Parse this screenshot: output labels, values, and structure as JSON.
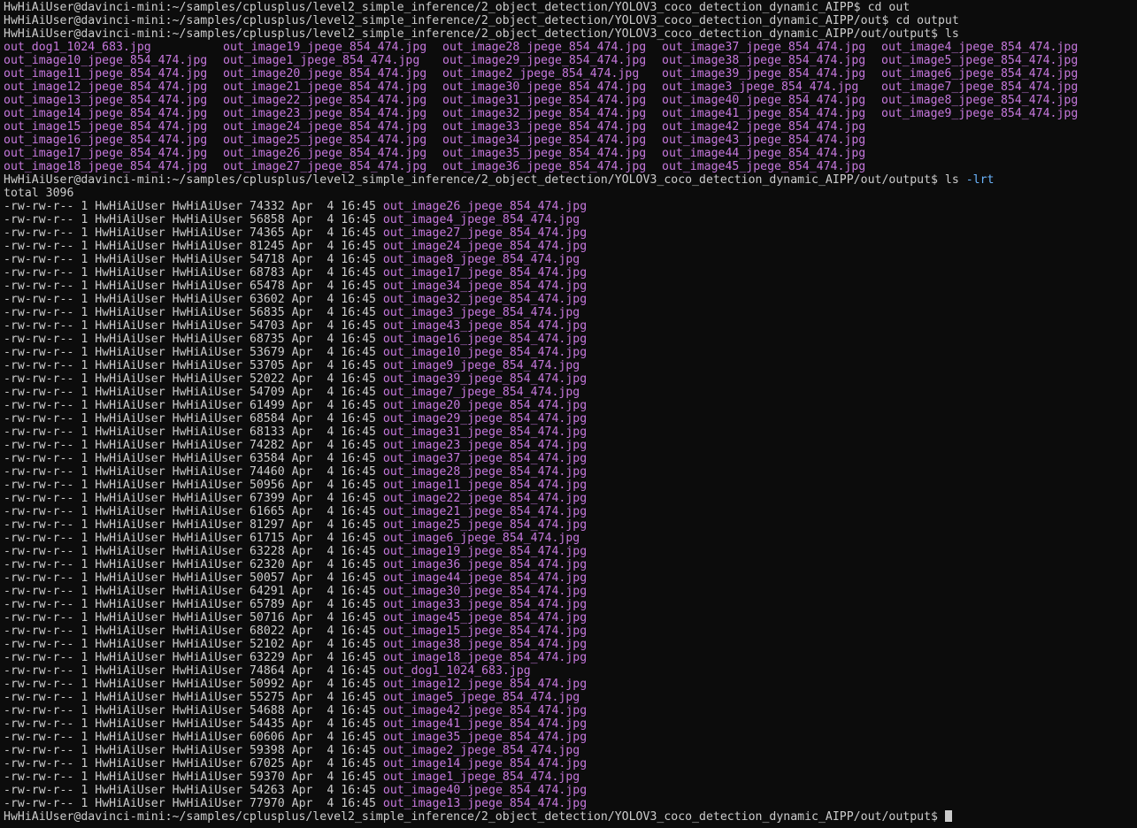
{
  "window": {
    "title": "Terminal"
  },
  "prompt_base": "HwHiAiUser@davinci-mini:~/samples/cplusplus/level2_simple_inference/2_object_detection/YOLOV3_coco_detection_dynamic_AIPP",
  "history": [
    {
      "prompt": "HwHiAiUser@davinci-mini:~/samples/cplusplus/level2_simple_inference/2_object_detection/YOLOV3_coco_detection_dynamic_AIPP$ ",
      "cmd": "cd out"
    },
    {
      "prompt": "HwHiAiUser@davinci-mini:~/samples/cplusplus/level2_simple_inference/2_object_detection/YOLOV3_coco_detection_dynamic_AIPP/out$ ",
      "cmd": "cd output"
    },
    {
      "prompt": "HwHiAiUser@davinci-mini:~/samples/cplusplus/level2_simple_inference/2_object_detection/YOLOV3_coco_detection_dynamic_AIPP/out/output$ ",
      "cmd": "ls"
    }
  ],
  "ls_columns": [
    [
      "out_dog1_1024_683.jpg",
      "out_image10_jpege_854_474.jpg",
      "out_image11_jpege_854_474.jpg",
      "out_image12_jpege_854_474.jpg",
      "out_image13_jpege_854_474.jpg",
      "out_image14_jpege_854_474.jpg",
      "out_image15_jpege_854_474.jpg",
      "out_image16_jpege_854_474.jpg",
      "out_image17_jpege_854_474.jpg",
      "out_image18_jpege_854_474.jpg"
    ],
    [
      "out_image19_jpege_854_474.jpg",
      "out_image1_jpege_854_474.jpg",
      "out_image20_jpege_854_474.jpg",
      "out_image21_jpege_854_474.jpg",
      "out_image22_jpege_854_474.jpg",
      "out_image23_jpege_854_474.jpg",
      "out_image24_jpege_854_474.jpg",
      "out_image25_jpege_854_474.jpg",
      "out_image26_jpege_854_474.jpg",
      "out_image27_jpege_854_474.jpg"
    ],
    [
      "out_image28_jpege_854_474.jpg",
      "out_image29_jpege_854_474.jpg",
      "out_image2_jpege_854_474.jpg",
      "out_image30_jpege_854_474.jpg",
      "out_image31_jpege_854_474.jpg",
      "out_image32_jpege_854_474.jpg",
      "out_image33_jpege_854_474.jpg",
      "out_image34_jpege_854_474.jpg",
      "out_image35_jpege_854_474.jpg",
      "out_image36_jpege_854_474.jpg"
    ],
    [
      "out_image37_jpege_854_474.jpg",
      "out_image38_jpege_854_474.jpg",
      "out_image39_jpege_854_474.jpg",
      "out_image3_jpege_854_474.jpg",
      "out_image40_jpege_854_474.jpg",
      "out_image41_jpege_854_474.jpg",
      "out_image42_jpege_854_474.jpg",
      "out_image43_jpege_854_474.jpg",
      "out_image44_jpege_854_474.jpg",
      "out_image45_jpege_854_474.jpg"
    ],
    [
      "out_image4_jpege_854_474.jpg",
      "out_image5_jpege_854_474.jpg",
      "out_image6_jpege_854_474.jpg",
      "out_image7_jpege_854_474.jpg",
      "out_image8_jpege_854_474.jpg",
      "out_image9_jpege_854_474.jpg"
    ]
  ],
  "lrt_command": {
    "prompt": "HwHiAiUser@davinci-mini:~/samples/cplusplus/level2_simple_inference/2_object_detection/YOLOV3_coco_detection_dynamic_AIPP/out/output$ ",
    "cmd": "ls ",
    "opt": "-lrt"
  },
  "total": "total 3096",
  "listing_common": {
    "perms": "-rw-rw-r--",
    "links": "1",
    "owner": "HwHiAiUser",
    "group": "HwHiAiUser",
    "month": "Apr",
    "day": "4",
    "time": "16:45"
  },
  "listing": [
    {
      "size": "74332",
      "name": "out_image26_jpege_854_474.jpg"
    },
    {
      "size": "56858",
      "name": "out_image4_jpege_854_474.jpg"
    },
    {
      "size": "74365",
      "name": "out_image27_jpege_854_474.jpg"
    },
    {
      "size": "81245",
      "name": "out_image24_jpege_854_474.jpg"
    },
    {
      "size": "54718",
      "name": "out_image8_jpege_854_474.jpg"
    },
    {
      "size": "68783",
      "name": "out_image17_jpege_854_474.jpg"
    },
    {
      "size": "65478",
      "name": "out_image34_jpege_854_474.jpg"
    },
    {
      "size": "63602",
      "name": "out_image32_jpege_854_474.jpg"
    },
    {
      "size": "56835",
      "name": "out_image3_jpege_854_474.jpg"
    },
    {
      "size": "54703",
      "name": "out_image43_jpege_854_474.jpg"
    },
    {
      "size": "68735",
      "name": "out_image16_jpege_854_474.jpg"
    },
    {
      "size": "53679",
      "name": "out_image10_jpege_854_474.jpg"
    },
    {
      "size": "53705",
      "name": "out_image9_jpege_854_474.jpg"
    },
    {
      "size": "52022",
      "name": "out_image39_jpege_854_474.jpg"
    },
    {
      "size": "54709",
      "name": "out_image7_jpege_854_474.jpg"
    },
    {
      "size": "61499",
      "name": "out_image20_jpege_854_474.jpg"
    },
    {
      "size": "68584",
      "name": "out_image29_jpege_854_474.jpg"
    },
    {
      "size": "68133",
      "name": "out_image31_jpege_854_474.jpg"
    },
    {
      "size": "74282",
      "name": "out_image23_jpege_854_474.jpg"
    },
    {
      "size": "63584",
      "name": "out_image37_jpege_854_474.jpg"
    },
    {
      "size": "74460",
      "name": "out_image28_jpege_854_474.jpg"
    },
    {
      "size": "50956",
      "name": "out_image11_jpege_854_474.jpg"
    },
    {
      "size": "67399",
      "name": "out_image22_jpege_854_474.jpg"
    },
    {
      "size": "61665",
      "name": "out_image21_jpege_854_474.jpg"
    },
    {
      "size": "81297",
      "name": "out_image25_jpege_854_474.jpg"
    },
    {
      "size": "61715",
      "name": "out_image6_jpege_854_474.jpg"
    },
    {
      "size": "63228",
      "name": "out_image19_jpege_854_474.jpg"
    },
    {
      "size": "62320",
      "name": "out_image36_jpege_854_474.jpg"
    },
    {
      "size": "50057",
      "name": "out_image44_jpege_854_474.jpg"
    },
    {
      "size": "64291",
      "name": "out_image30_jpege_854_474.jpg"
    },
    {
      "size": "65789",
      "name": "out_image33_jpege_854_474.jpg"
    },
    {
      "size": "50716",
      "name": "out_image45_jpege_854_474.jpg"
    },
    {
      "size": "68022",
      "name": "out_image15_jpege_854_474.jpg"
    },
    {
      "size": "52102",
      "name": "out_image38_jpege_854_474.jpg"
    },
    {
      "size": "63229",
      "name": "out_image18_jpege_854_474.jpg"
    },
    {
      "size": "74864",
      "name": "out_dog1_1024_683.jpg"
    },
    {
      "size": "50992",
      "name": "out_image12_jpege_854_474.jpg"
    },
    {
      "size": "55275",
      "name": "out_image5_jpege_854_474.jpg"
    },
    {
      "size": "54688",
      "name": "out_image42_jpege_854_474.jpg"
    },
    {
      "size": "54435",
      "name": "out_image41_jpege_854_474.jpg"
    },
    {
      "size": "60606",
      "name": "out_image35_jpege_854_474.jpg"
    },
    {
      "size": "59398",
      "name": "out_image2_jpege_854_474.jpg"
    },
    {
      "size": "67025",
      "name": "out_image14_jpege_854_474.jpg"
    },
    {
      "size": "59370",
      "name": "out_image1_jpege_854_474.jpg"
    },
    {
      "size": "54263",
      "name": "out_image40_jpege_854_474.jpg"
    },
    {
      "size": "77970",
      "name": "out_image13_jpege_854_474.jpg"
    }
  ],
  "final_prompt": "HwHiAiUser@davinci-mini:~/samples/cplusplus/level2_simple_inference/2_object_detection/YOLOV3_coco_detection_dynamic_AIPP/out/output$ ",
  "colors": {
    "background": "#0c0c0c",
    "text": "#cccccc",
    "filename": "#c678dd",
    "option": "#6cb6ff"
  }
}
